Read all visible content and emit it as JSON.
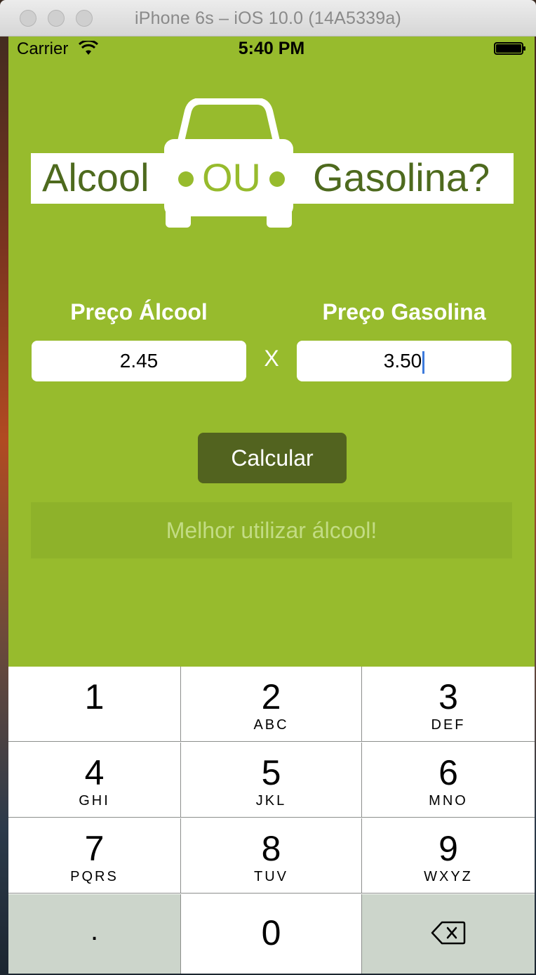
{
  "window": {
    "title": "iPhone 6s – iOS 10.0 (14A5339a)"
  },
  "statusbar": {
    "carrier": "Carrier",
    "time": "5:40 PM"
  },
  "logo": {
    "word_left": "Alcool",
    "word_middle": "OU",
    "word_right": "Gasolina?"
  },
  "form": {
    "alcool_label": "Preço Álcool",
    "alcool_value": "2.45",
    "separator": "X",
    "gasolina_label": "Preço Gasolina",
    "gasolina_value": "3.50",
    "calculate_label": "Calcular",
    "result_text": "Melhor utilizar álcool!"
  },
  "keypad": {
    "keys": [
      {
        "num": "1",
        "letters": ""
      },
      {
        "num": "2",
        "letters": "ABC"
      },
      {
        "num": "3",
        "letters": "DEF"
      },
      {
        "num": "4",
        "letters": "GHI"
      },
      {
        "num": "5",
        "letters": "JKL"
      },
      {
        "num": "6",
        "letters": "MNO"
      },
      {
        "num": "7",
        "letters": "PQRS"
      },
      {
        "num": "8",
        "letters": "TUV"
      },
      {
        "num": "9",
        "letters": "WXYZ"
      }
    ],
    "dot": ".",
    "zero": "0"
  },
  "colors": {
    "background": "#97bb2d",
    "button": "#52631f",
    "logo_text": "#4e6a1e",
    "result_text": "#c3dc84"
  }
}
